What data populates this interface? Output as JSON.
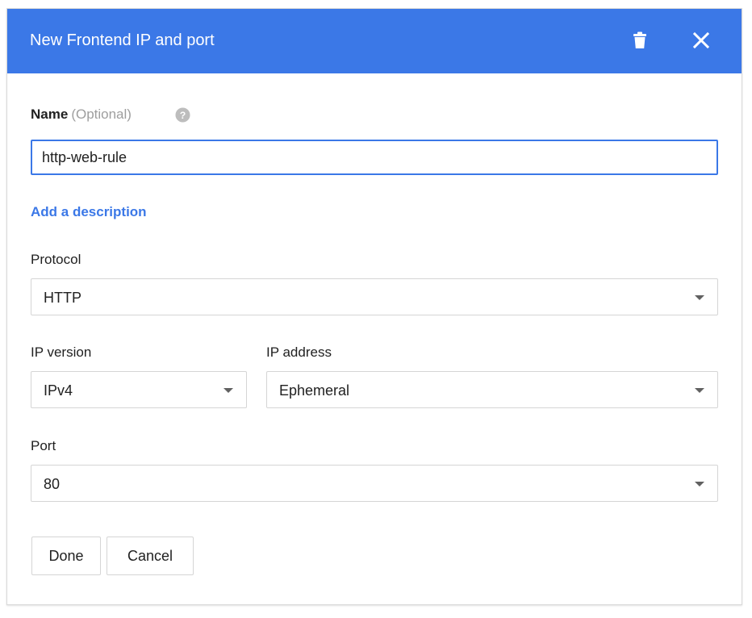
{
  "header": {
    "title": "New Frontend IP and port",
    "background_color": "#3b78e7",
    "delete_icon": "trash-icon",
    "close_icon": "close-icon"
  },
  "name_field": {
    "label": "Name",
    "optional_text": "(Optional)",
    "help_icon": "help-circle-icon",
    "value": "http-web-rule"
  },
  "add_description_link": "Add a description",
  "protocol": {
    "label": "Protocol",
    "value": "HTTP"
  },
  "ip_version": {
    "label": "IP version",
    "value": "IPv4"
  },
  "ip_address": {
    "label": "IP address",
    "value": "Ephemeral"
  },
  "port": {
    "label": "Port",
    "value": "80"
  },
  "actions": {
    "done_label": "Done",
    "cancel_label": "Cancel"
  }
}
